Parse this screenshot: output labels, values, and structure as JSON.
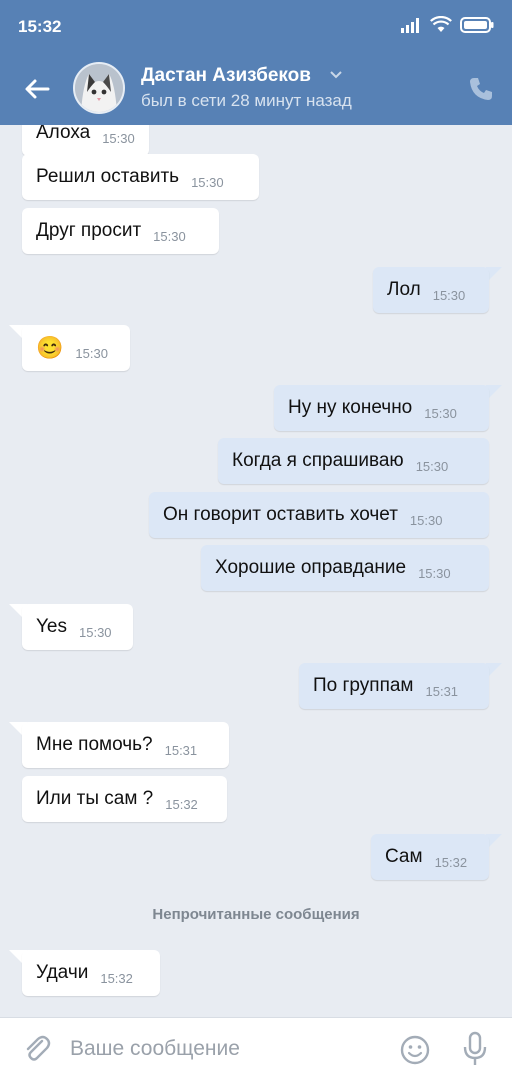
{
  "status_bar": {
    "time": "15:32"
  },
  "header": {
    "contact_name": "Дастан Азизбеков",
    "contact_status": "был в сети 28 минут назад"
  },
  "messages": [
    {
      "direction": "in",
      "text": "Алоха",
      "time": "15:30"
    },
    {
      "direction": "in",
      "text": "Решил оставить",
      "time": "15:30"
    },
    {
      "direction": "in",
      "text": "Друг просит",
      "time": "15:30"
    },
    {
      "direction": "out",
      "text": "Лол",
      "time": "15:30"
    },
    {
      "direction": "in",
      "text": "😊",
      "time": "15:30",
      "emoji": true
    },
    {
      "direction": "out",
      "text": "Ну ну конечно",
      "time": "15:30"
    },
    {
      "direction": "out",
      "text": "Когда я спрашиваю",
      "time": "15:30"
    },
    {
      "direction": "out",
      "text": "Он говорит оставить хочет",
      "time": "15:30"
    },
    {
      "direction": "out",
      "text": "Хорошие оправдание",
      "time": "15:30"
    },
    {
      "direction": "in",
      "text": "Yes",
      "time": "15:30"
    },
    {
      "direction": "out",
      "text": "По группам",
      "time": "15:31"
    },
    {
      "direction": "in",
      "text": "Мне помочь?",
      "time": "15:31"
    },
    {
      "direction": "in",
      "text": "Или ты сам ?",
      "time": "15:32"
    },
    {
      "direction": "out",
      "text": "Сам",
      "time": "15:32"
    },
    {
      "direction": "in",
      "text": "Удачи",
      "time": "15:32"
    }
  ],
  "unread_divider": "Непрочитанные сообщения",
  "composer": {
    "placeholder": "Ваше сообщение"
  },
  "colors": {
    "header_bg": "#5781b5",
    "chat_bg": "#e8ecf2",
    "incoming_bubble": "#ffffff",
    "outgoing_bubble": "#dce7f6"
  }
}
